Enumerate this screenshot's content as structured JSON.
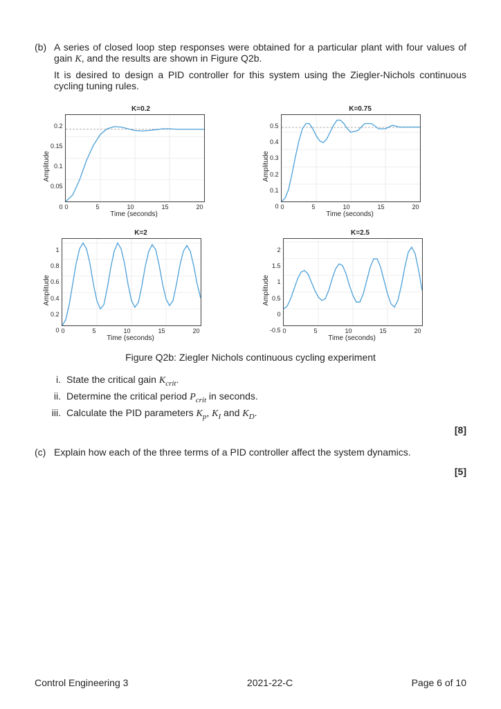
{
  "part_b": {
    "label": "(b)",
    "para1": "A series of closed loop step responses were obtained for a particular plant with four values of gain K, and the results are shown in Figure Q2b.",
    "para2": "It is desired to design a PID controller for this system using the Ziegler-Nichols continuous cycling tuning rules."
  },
  "figure_caption": "Figure Q2b: Ziegler Nichols continuous cycling experiment",
  "sub_i": {
    "label": "i.",
    "text": "State the critical gain "
  },
  "sub_i_sym": "K",
  "sub_i_sub": "crit",
  "sub_ii": {
    "label": "ii.",
    "text": "Determine the critical period ",
    "text2": " in seconds."
  },
  "sub_ii_sym": "P",
  "sub_ii_sub": "crit",
  "sub_iii": {
    "label": "iii.",
    "text": "Calculate the PID parameters "
  },
  "sub_iii_k": "K",
  "sub_iii_p": "p",
  "sub_iii_i": "I",
  "sub_iii_d": "D",
  "sub_iii_and": " and ",
  "sub_iii_sep": ", ",
  "marks_b": "[8]",
  "part_c": {
    "label": "(c)",
    "text": "Explain how each of the three terms of a PID controller affect the system dynamics."
  },
  "marks_c": "[5]",
  "footer": {
    "left": "Control Engineering 3",
    "mid": "2021-22-C",
    "right_prefix": "Page  ",
    "right_page": "6 of 10"
  },
  "chart_common": {
    "xlabel": "Time (seconds)",
    "ylabel": "Amplitude",
    "xticks": [
      "0",
      "5",
      "10",
      "15",
      "20"
    ],
    "xrange": [
      0,
      20
    ]
  },
  "chart_data": [
    {
      "type": "line",
      "title": "K=0.2",
      "yticks": [
        "0",
        "0.05",
        "0.1",
        "0.15",
        "0.2"
      ],
      "yrange": [
        0,
        0.2
      ],
      "dashed_level": 0.167,
      "x": [
        0,
        1,
        2,
        3,
        4,
        5,
        6,
        7,
        8,
        9,
        10,
        11,
        12,
        13,
        14,
        15,
        16,
        17,
        18,
        19,
        20
      ],
      "y": [
        0,
        0.015,
        0.05,
        0.095,
        0.13,
        0.155,
        0.168,
        0.173,
        0.172,
        0.168,
        0.164,
        0.163,
        0.164,
        0.166,
        0.168,
        0.168,
        0.167,
        0.167,
        0.167,
        0.167,
        0.167
      ]
    },
    {
      "type": "line",
      "title": "K=0.75",
      "yticks": [
        "0",
        "0.1",
        "0.2",
        "0.3",
        "0.4",
        "0.5"
      ],
      "yrange": [
        0,
        0.5
      ],
      "dashed_level": 0.428,
      "x": [
        0,
        0.5,
        1,
        1.5,
        2,
        2.5,
        3,
        3.5,
        4,
        4.5,
        5,
        5.5,
        6,
        6.5,
        7,
        7.5,
        8,
        8.5,
        9,
        9.5,
        10,
        11,
        12,
        13,
        14,
        15,
        16,
        17,
        18,
        19,
        20
      ],
      "y": [
        0,
        0.02,
        0.07,
        0.16,
        0.26,
        0.35,
        0.42,
        0.45,
        0.45,
        0.42,
        0.38,
        0.35,
        0.34,
        0.36,
        0.4,
        0.44,
        0.47,
        0.47,
        0.45,
        0.42,
        0.4,
        0.41,
        0.45,
        0.45,
        0.42,
        0.42,
        0.44,
        0.43,
        0.43,
        0.43,
        0.43
      ]
    },
    {
      "type": "line",
      "title": "K=2",
      "yticks": [
        "0",
        "0.2",
        "0.4",
        "0.6",
        "0.8",
        "1"
      ],
      "yrange": [
        0,
        1.05
      ],
      "x": [
        0,
        0.5,
        1,
        1.5,
        2,
        2.5,
        3,
        3.5,
        4,
        4.5,
        5,
        5.5,
        6,
        6.5,
        7,
        7.5,
        8,
        8.5,
        9,
        9.5,
        10,
        10.5,
        11,
        11.5,
        12,
        12.5,
        13,
        13.5,
        14,
        14.5,
        15,
        15.5,
        16,
        16.5,
        17,
        17.5,
        18,
        18.5,
        19,
        19.5,
        20
      ],
      "y": [
        0,
        0.07,
        0.25,
        0.5,
        0.75,
        0.93,
        1.0,
        0.93,
        0.75,
        0.5,
        0.3,
        0.2,
        0.25,
        0.45,
        0.7,
        0.9,
        1.0,
        0.93,
        0.75,
        0.5,
        0.3,
        0.22,
        0.28,
        0.48,
        0.72,
        0.9,
        0.98,
        0.92,
        0.73,
        0.5,
        0.32,
        0.24,
        0.3,
        0.5,
        0.73,
        0.9,
        0.97,
        0.9,
        0.72,
        0.5,
        0.33
      ]
    },
    {
      "type": "line",
      "title": "K=2.5",
      "yticks": [
        "-0.5",
        "0",
        "0.5",
        "1",
        "1.5",
        "2"
      ],
      "yrange": [
        -0.5,
        2.1
      ],
      "x": [
        0,
        0.5,
        1,
        1.5,
        2,
        2.5,
        3,
        3.5,
        4,
        4.5,
        5,
        5.5,
        6,
        6.5,
        7,
        7.5,
        8,
        8.5,
        9,
        9.5,
        10,
        10.5,
        11,
        11.5,
        12,
        12.5,
        13,
        13.5,
        14,
        14.5,
        15,
        15.5,
        16,
        16.5,
        17,
        17.5,
        18,
        18.5,
        19,
        19.5,
        20
      ],
      "y": [
        0,
        0.08,
        0.3,
        0.6,
        0.9,
        1.1,
        1.15,
        1.05,
        0.8,
        0.55,
        0.35,
        0.25,
        0.3,
        0.55,
        0.9,
        1.2,
        1.35,
        1.3,
        1.05,
        0.7,
        0.4,
        0.2,
        0.2,
        0.45,
        0.85,
        1.25,
        1.5,
        1.5,
        1.25,
        0.85,
        0.45,
        0.15,
        0.05,
        0.25,
        0.7,
        1.25,
        1.7,
        1.85,
        1.65,
        1.15,
        0.55
      ]
    }
  ]
}
